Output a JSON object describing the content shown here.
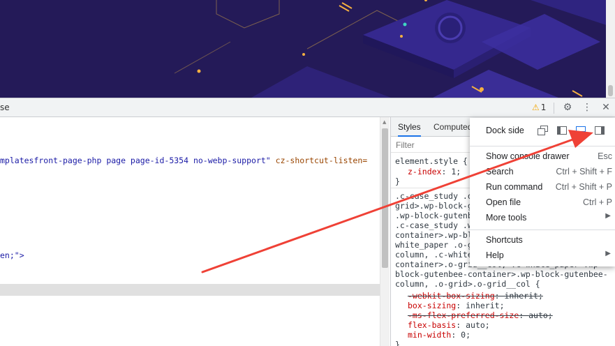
{
  "toolbar": {
    "partial_tab_label": "se",
    "warning_count": "1",
    "warning_icon": "warning-triangle-icon",
    "settings_icon": "gear-icon",
    "more_icon": "vertical-dots-icon",
    "close_icon": "close-icon"
  },
  "elements": {
    "lines": [
      {
        "pre": "mplatesfront-page-php page page-id-5354 no-webp-support\"",
        "attr": " cz-shortcut-listen="
      },
      {
        "text": "en;\">"
      }
    ]
  },
  "styles": {
    "tabs": [
      "Styles",
      "Computed"
    ],
    "filter_placeholder": "Filter",
    "element_style": {
      "selector": "element.style {",
      "prop": "z-index",
      "value": "1;",
      "close": "}"
    },
    "selector_lines": [
      ".c-case_study .o",
      "grid>.wp-block-gu",
      ".wp-block-gutenbe",
      ".c-case_study .w",
      "container>.wp-blo",
      "white_paper .o-g",
      "column, .c-white",
      "container>.o-grid__col, .c-white_paper .wp-",
      "block-gutenbee-container>.wp-block-gutenbee-",
      "column, .o-grid>.o-grid__col {"
    ],
    "declarations": [
      {
        "prop": "-webkit-box-sizing",
        "value": "inherit;",
        "struck": true
      },
      {
        "prop": "box-sizing",
        "value": "inherit;",
        "struck": false
      },
      {
        "prop": "-ms-flex-preferred-size",
        "value": "auto;",
        "struck": true
      },
      {
        "prop": "flex-basis",
        "value": "auto;",
        "struck": false
      },
      {
        "prop": "min-width",
        "value": "0;",
        "struck": false
      }
    ],
    "close": "}"
  },
  "menu": {
    "dock_label": "Dock side",
    "dock_options": [
      "undock-icon",
      "dock-left-icon",
      "dock-bottom-icon",
      "dock-right-icon"
    ],
    "items": [
      {
        "label": "Show console drawer",
        "shortcut": "Esc"
      },
      {
        "label": "Search",
        "shortcut": "Ctrl + Shift + F"
      },
      {
        "label": "Run command",
        "shortcut": "Ctrl + Shift + P"
      },
      {
        "label": "Open file",
        "shortcut": "Ctrl + P"
      },
      {
        "label": "More tools",
        "shortcut": ""
      }
    ],
    "items2": [
      {
        "label": "Shortcuts"
      },
      {
        "label": "Help"
      }
    ]
  },
  "colors": {
    "hero_bg": "#241a58",
    "accent": "#1a73e8",
    "arrow": "#ef4136"
  }
}
